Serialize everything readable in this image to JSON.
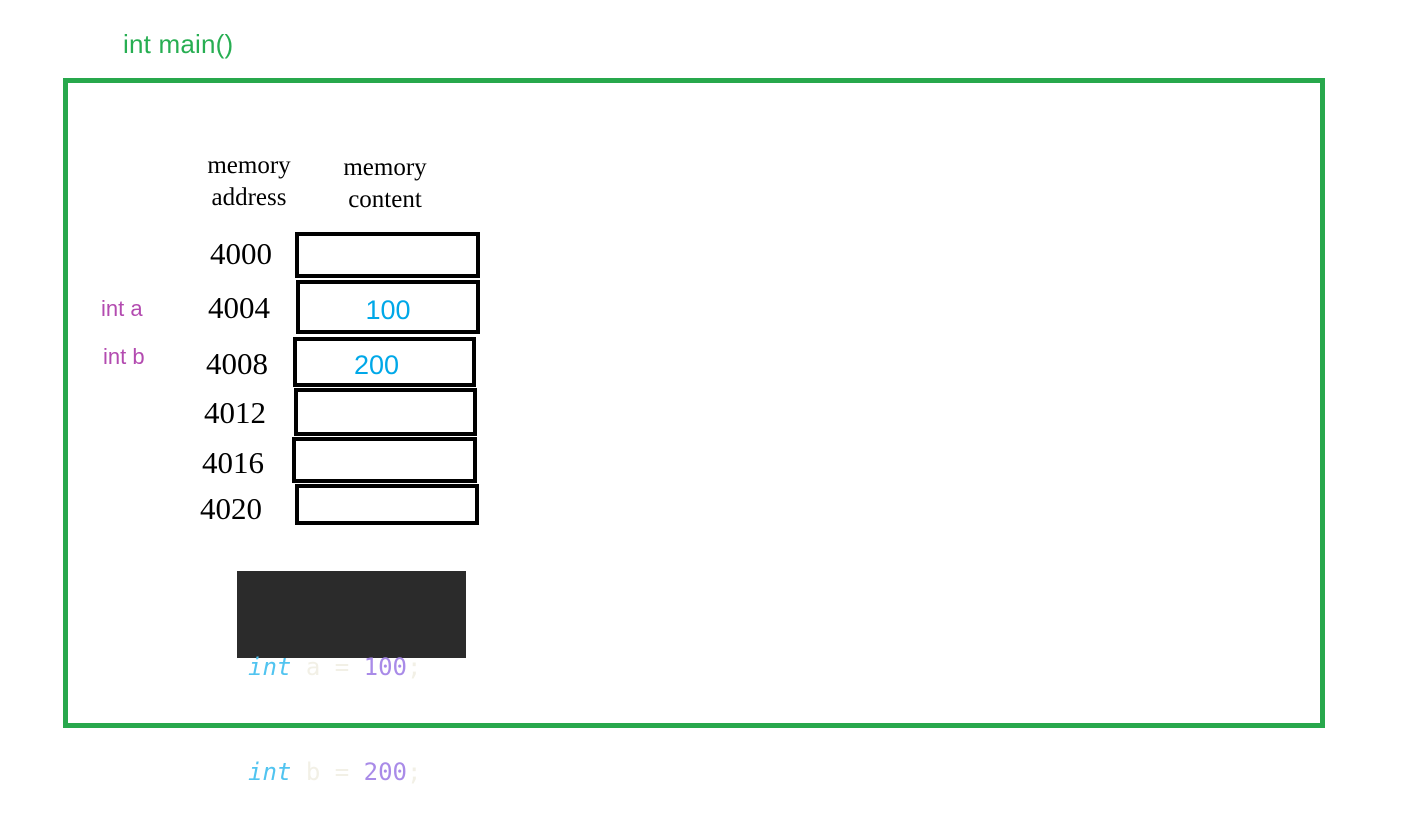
{
  "slide": {
    "title": "int main()",
    "title_color": "#27ae52",
    "frame_color": "#28a84c"
  },
  "table": {
    "headers": {
      "address": "memory\naddress",
      "content": "memory\ncontent"
    },
    "value_color": "#00a8e8",
    "cell_border_color": "#000000",
    "rows": [
      {
        "address": "4000",
        "value": "",
        "var": ""
      },
      {
        "address": "4004",
        "value": "100",
        "var": "int a"
      },
      {
        "address": "4008",
        "value": "200",
        "var": "int b"
      },
      {
        "address": "4012",
        "value": "",
        "var": ""
      },
      {
        "address": "4016",
        "value": "",
        "var": ""
      },
      {
        "address": "4020",
        "value": "",
        "var": ""
      }
    ]
  },
  "code": {
    "background": "#2b2b2b",
    "keyword_color": "#51c4f0",
    "number_color": "#a98be8",
    "identifier_color": "#f2f0e6",
    "lines": [
      {
        "kw": "int",
        "sp1": " ",
        "id": "a",
        "sp2": " ",
        "op": "=",
        "sp3": " ",
        "num": "100",
        "punc": ";"
      },
      {
        "kw": "int",
        "sp1": " ",
        "id": "b",
        "sp2": " ",
        "op": "=",
        "sp3": " ",
        "num": "200",
        "punc": ";"
      }
    ]
  }
}
